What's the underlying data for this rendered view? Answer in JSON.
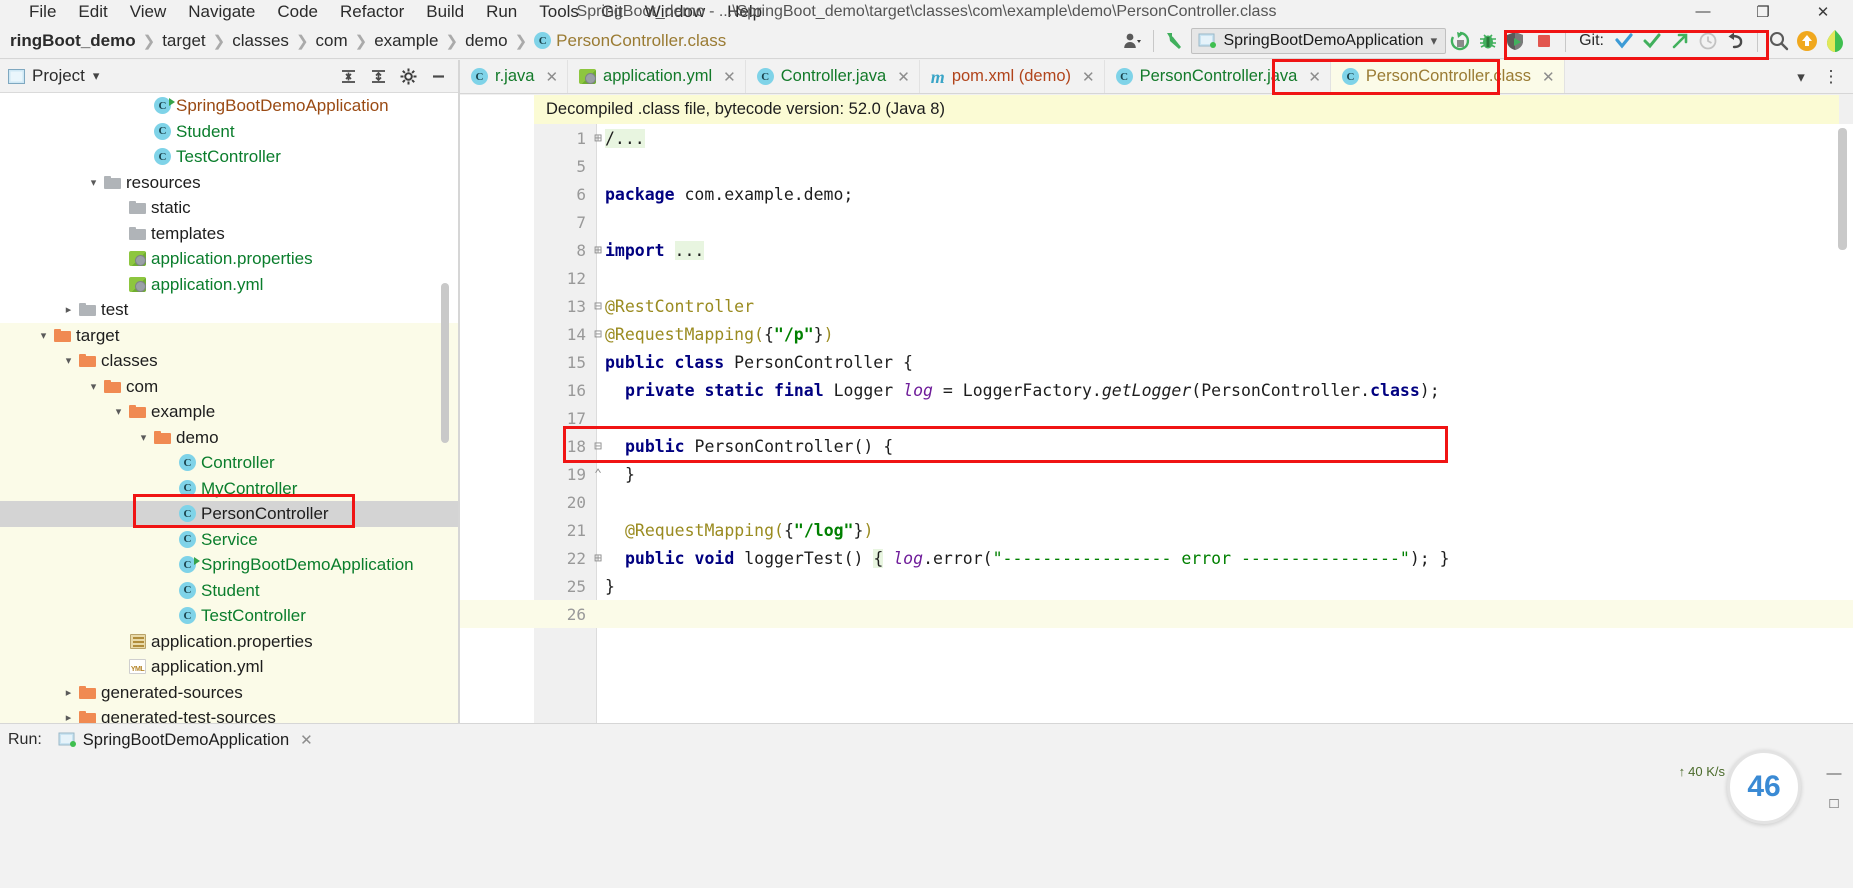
{
  "window": {
    "title": "SpringBoot_demo - ...\\SpringBoot_demo\\target\\classes\\com\\example\\demo\\PersonController.class",
    "minimize": "—",
    "maximize": "❐",
    "close": "✕"
  },
  "menubar": [
    {
      "label": "File"
    },
    {
      "label": "Edit"
    },
    {
      "label": "View"
    },
    {
      "label": "Navigate"
    },
    {
      "label": "Code"
    },
    {
      "label": "Refactor"
    },
    {
      "label": "Build"
    },
    {
      "label": "Run"
    },
    {
      "label": "Tools"
    },
    {
      "label": "Git"
    },
    {
      "label": "Window"
    },
    {
      "label": "Help"
    }
  ],
  "breadcrumbs": [
    {
      "label": "ringBoot_demo",
      "style": "bold"
    },
    {
      "label": "target",
      "style": "plain"
    },
    {
      "label": "classes",
      "style": "plain"
    },
    {
      "label": "com",
      "style": "plain"
    },
    {
      "label": "example",
      "style": "plain"
    },
    {
      "label": "demo",
      "style": "plain"
    },
    {
      "label": "PersonController.class",
      "style": "class"
    }
  ],
  "toolbar": {
    "run_config": "SpringBootDemoApplication",
    "git_label": "Git:",
    "icons": {
      "avatar": "account-icon",
      "build": "build-hammer-icon",
      "rerun": "rerun-icon",
      "debug": "debug-bug-icon",
      "coverage": "run-coverage-icon",
      "stop": "stop-icon",
      "update": "git-update-icon",
      "commit": "git-commit-icon",
      "push": "git-push-icon",
      "history": "git-history-icon",
      "rollback": "git-rollback-icon",
      "search": "search-everywhere-icon",
      "updates": "updates-available-icon"
    }
  },
  "project_panel": {
    "title": "Project",
    "dropdown": "▾",
    "actions": [
      "collapse-all-icon",
      "expand-all-icon",
      "settings-gear-icon",
      "hide-icon"
    ]
  },
  "tree": [
    {
      "indent": 5,
      "arrow": "",
      "icon": "class-run",
      "label": "SpringBootDemoApplication",
      "color": "brown",
      "state": "normal"
    },
    {
      "indent": 5,
      "arrow": "",
      "icon": "class",
      "label": "Student",
      "color": "green",
      "state": "normal"
    },
    {
      "indent": 5,
      "arrow": "",
      "icon": "class",
      "label": "TestController",
      "color": "green",
      "state": "normal"
    },
    {
      "indent": 3,
      "arrow": "v",
      "icon": "folder-res",
      "label": "resources",
      "color": "dark",
      "state": "normal"
    },
    {
      "indent": 4,
      "arrow": "",
      "icon": "folder",
      "label": "static",
      "color": "dark",
      "state": "normal"
    },
    {
      "indent": 4,
      "arrow": "",
      "icon": "folder",
      "label": "templates",
      "color": "dark",
      "state": "normal"
    },
    {
      "indent": 4,
      "arrow": "",
      "icon": "leaf",
      "label": "application.properties",
      "color": "green",
      "state": "normal"
    },
    {
      "indent": 4,
      "arrow": "",
      "icon": "leaf",
      "label": "application.yml",
      "color": "green",
      "state": "normal"
    },
    {
      "indent": 2,
      "arrow": ">",
      "icon": "folder",
      "label": "test",
      "color": "dark",
      "state": "normal"
    },
    {
      "indent": 1,
      "arrow": "v",
      "icon": "folder-o",
      "label": "target",
      "color": "dark",
      "state": "highlight"
    },
    {
      "indent": 2,
      "arrow": "v",
      "icon": "folder-o",
      "label": "classes",
      "color": "dark",
      "state": "highlight"
    },
    {
      "indent": 3,
      "arrow": "v",
      "icon": "folder-o",
      "label": "com",
      "color": "dark",
      "state": "highlight"
    },
    {
      "indent": 4,
      "arrow": "v",
      "icon": "folder-o",
      "label": "example",
      "color": "dark",
      "state": "highlight"
    },
    {
      "indent": 5,
      "arrow": "v",
      "icon": "folder-o",
      "label": "demo",
      "color": "dark",
      "state": "highlight"
    },
    {
      "indent": 6,
      "arrow": "",
      "icon": "class",
      "label": "Controller",
      "color": "green",
      "state": "highlight"
    },
    {
      "indent": 6,
      "arrow": "",
      "icon": "class",
      "label": "MyController",
      "color": "green",
      "state": "highlight"
    },
    {
      "indent": 6,
      "arrow": "",
      "icon": "class",
      "label": "PersonController",
      "color": "dark",
      "state": "selected"
    },
    {
      "indent": 6,
      "arrow": "",
      "icon": "class",
      "label": "Service",
      "color": "green",
      "state": "highlight"
    },
    {
      "indent": 6,
      "arrow": "",
      "icon": "class-run",
      "label": "SpringBootDemoApplication",
      "color": "green",
      "state": "highlight"
    },
    {
      "indent": 6,
      "arrow": "",
      "icon": "class",
      "label": "Student",
      "color": "green",
      "state": "highlight"
    },
    {
      "indent": 6,
      "arrow": "",
      "icon": "class",
      "label": "TestController",
      "color": "green",
      "state": "highlight"
    },
    {
      "indent": 4,
      "arrow": "",
      "icon": "props",
      "label": "application.properties",
      "color": "dark",
      "state": "highlight"
    },
    {
      "indent": 4,
      "arrow": "",
      "icon": "yml",
      "label": "application.yml",
      "color": "dark",
      "state": "highlight"
    },
    {
      "indent": 2,
      "arrow": ">",
      "icon": "folder-o",
      "label": "generated-sources",
      "color": "dark",
      "state": "highlight"
    },
    {
      "indent": 2,
      "arrow": ">",
      "icon": "folder-o",
      "label": "generated-test-sources",
      "color": "dark",
      "state": "highlight"
    }
  ],
  "tabs": [
    {
      "label": "r.java",
      "icon": "class",
      "color": "green",
      "active": false,
      "truncated": true
    },
    {
      "label": "application.yml",
      "icon": "leaf",
      "color": "green",
      "active": false,
      "truncated": false
    },
    {
      "label": "Controller.java",
      "icon": "class",
      "color": "green",
      "active": false,
      "truncated": false
    },
    {
      "label": "pom.xml (demo)",
      "icon": "maven",
      "color": "red",
      "active": false,
      "truncated": false
    },
    {
      "label": "PersonController.java",
      "icon": "class",
      "color": "green",
      "active": false,
      "truncated": false
    },
    {
      "label": "PersonController.class",
      "icon": "class",
      "color": "olive",
      "active": true,
      "truncated": false
    }
  ],
  "tabs_overflow": {
    "chevron": "▾",
    "more": "⋮"
  },
  "editor": {
    "banner": "Decompiled .class file, bytecode version: 52.0 (Java 8)",
    "lines": [
      {
        "no": "1",
        "fold": "+",
        "highlight": false,
        "tokens": [
          {
            "t": "/...",
            "c": "cmt-fold"
          }
        ]
      },
      {
        "no": "5",
        "fold": "",
        "highlight": false,
        "tokens": []
      },
      {
        "no": "6",
        "fold": "",
        "highlight": false,
        "tokens": [
          {
            "t": "package",
            "c": "kw"
          },
          {
            "t": " com.example.demo;",
            "c": "txt"
          }
        ]
      },
      {
        "no": "7",
        "fold": "",
        "highlight": false,
        "tokens": []
      },
      {
        "no": "8",
        "fold": "+",
        "highlight": false,
        "tokens": [
          {
            "t": "import",
            "c": "kw"
          },
          {
            "t": " ",
            "c": "txt"
          },
          {
            "t": "...",
            "c": "ell"
          }
        ]
      },
      {
        "no": "12",
        "fold": "",
        "highlight": false,
        "tokens": []
      },
      {
        "no": "13",
        "fold": "-",
        "highlight": false,
        "tokens": [
          {
            "t": "@RestController",
            "c": "ann"
          }
        ]
      },
      {
        "no": "14",
        "fold": "-",
        "highlight": false,
        "tokens": [
          {
            "t": "@RequestMapping(",
            "c": "ann"
          },
          {
            "t": "{",
            "c": "txt"
          },
          {
            "t": "\"/p\"",
            "c": "str"
          },
          {
            "t": "}",
            "c": "txt"
          },
          {
            "t": ")",
            "c": "ann"
          }
        ]
      },
      {
        "no": "15",
        "fold": "",
        "highlight": false,
        "tokens": [
          {
            "t": "public class",
            "c": "kw"
          },
          {
            "t": " PersonController {",
            "c": "txt"
          }
        ]
      },
      {
        "no": "16",
        "fold": "",
        "highlight": false,
        "indent": 2,
        "tokens": [
          {
            "t": "private static final",
            "c": "kw"
          },
          {
            "t": " Logger ",
            "c": "txt"
          },
          {
            "t": "log",
            "c": "fld"
          },
          {
            "t": " = LoggerFactory.",
            "c": "txt"
          },
          {
            "t": "getLogger",
            "c": "mth"
          },
          {
            "t": "(PersonController.",
            "c": "txt"
          },
          {
            "t": "class",
            "c": "kw"
          },
          {
            "t": ");",
            "c": "txt"
          }
        ]
      },
      {
        "no": "17",
        "fold": "",
        "highlight": false,
        "tokens": []
      },
      {
        "no": "18",
        "fold": "-",
        "highlight": false,
        "indent": 2,
        "tokens": [
          {
            "t": "public",
            "c": "kw"
          },
          {
            "t": " PersonController() {",
            "c": "txt"
          }
        ]
      },
      {
        "no": "19",
        "fold": "^",
        "highlight": false,
        "indent": 2,
        "tokens": [
          {
            "t": "}",
            "c": "txt"
          }
        ]
      },
      {
        "no": "20",
        "fold": "",
        "highlight": false,
        "tokens": []
      },
      {
        "no": "21",
        "fold": "",
        "highlight": false,
        "indent": 2,
        "tokens": [
          {
            "t": "@RequestMapping(",
            "c": "ann"
          },
          {
            "t": "{",
            "c": "txt"
          },
          {
            "t": "\"/log\"",
            "c": "str"
          },
          {
            "t": "}",
            "c": "txt"
          },
          {
            "t": ")",
            "c": "ann"
          }
        ]
      },
      {
        "no": "22",
        "fold": "+",
        "highlight": false,
        "indent": 2,
        "tokens": [
          {
            "t": "public void",
            "c": "kw"
          },
          {
            "t": " ",
            "c": "txt"
          },
          {
            "t": "loggerTest",
            "c": "txt"
          },
          {
            "t": "() ",
            "c": "txt"
          },
          {
            "t": "{",
            "c": "brace-hl"
          },
          {
            "t": " ",
            "c": "txt"
          },
          {
            "t": "log",
            "c": "fld"
          },
          {
            "t": ".error(",
            "c": "txt"
          },
          {
            "t": "\"----------------- error ----------------\"",
            "c": "strn"
          },
          {
            "t": "); ",
            "c": "txt"
          },
          {
            "t": "}",
            "c": "txt"
          }
        ]
      },
      {
        "no": "25",
        "fold": "",
        "highlight": false,
        "tokens": [
          {
            "t": "}",
            "c": "txt"
          }
        ]
      },
      {
        "no": "26",
        "fold": "",
        "highlight": true,
        "tokens": []
      }
    ]
  },
  "runbar": {
    "label": "Run:",
    "tab": "SpringBootDemoApplication",
    "close": "✕"
  },
  "status": {
    "network_speed": "40 K/s",
    "widget_value": "46"
  },
  "colors": {
    "accent_red": "#f01414",
    "tab_active_bg": "#fbfbe8",
    "banner_bg": "#fbfbd4",
    "keyword": "#000080",
    "string": "#008000",
    "annotation": "#9a8b20",
    "field": "#6f1d9a"
  }
}
